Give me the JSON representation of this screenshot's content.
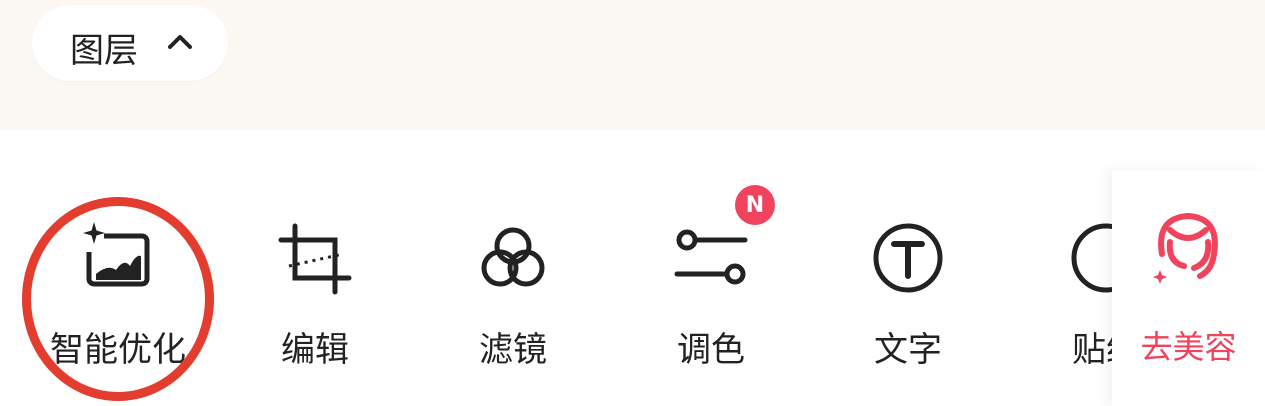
{
  "layer_button": {
    "label": "图层",
    "icon": "chevron-up-icon"
  },
  "tools": [
    {
      "label": "智能优化",
      "icon": "smart-optimize-icon"
    },
    {
      "label": "编辑",
      "icon": "crop-icon"
    },
    {
      "label": "滤镜",
      "icon": "filter-circles-icon"
    },
    {
      "label": "调色",
      "icon": "adjust-sliders-icon",
      "badge": "N"
    },
    {
      "label": "文字",
      "icon": "text-circle-icon"
    },
    {
      "label": "贴纸",
      "icon": "sticker-icon"
    }
  ],
  "beauty_button": {
    "label": "去美容",
    "icon": "face-icon"
  },
  "colors": {
    "accent": "#f0435e",
    "annotation": "#e23d2f",
    "text": "#222222",
    "top_bg": "#fbf7f2"
  }
}
